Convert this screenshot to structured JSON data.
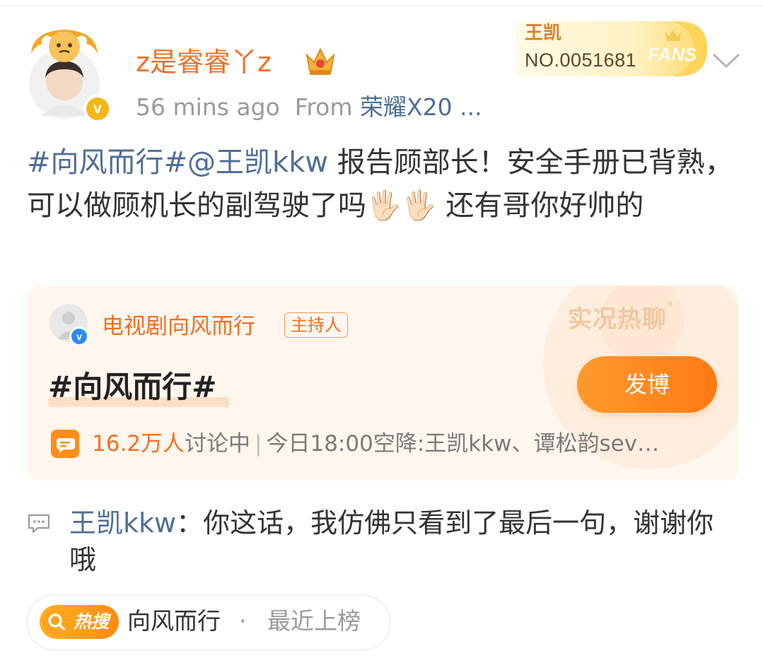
{
  "post": {
    "author": "z是睿睿丫z",
    "time": "56 mins ago",
    "from_label": "From",
    "device": "荣耀X20 ...",
    "fans_badge": {
      "name": "王凯",
      "number": "NO.0051681",
      "label": "FANS"
    },
    "text_tags": "#向风而行#@王凯kkw",
    "text_body": " 报告顾部长！安全手册已背熟，可以做顾机长的副驾驶了吗",
    "emoji": "🖐🏻🖐🏻",
    "text_tail": " 还有哥你好帅的"
  },
  "topic_card": {
    "host_name": "电视剧向风而行",
    "host_role": "主持人",
    "live_label": "实况热聊",
    "title": "#向风而行#",
    "post_button": "发博",
    "count": "16.2万人",
    "discussing": "讨论中",
    "separator": "|",
    "announcement": "今日18:00空降:王凯kkw、谭松韵sev…"
  },
  "comment": {
    "author": "王凯kkw",
    "colon": "：",
    "text": "你这话，我仿佛只看到了最后一句，谢谢你哦"
  },
  "hot_search": {
    "badge": "热搜",
    "topic": "向风而行",
    "dot": "·",
    "status": "最近上榜"
  },
  "colors": {
    "username": "#f27022",
    "link": "#4e6e95",
    "button": "#ff8a14",
    "card_bg": "#fff6ee"
  }
}
